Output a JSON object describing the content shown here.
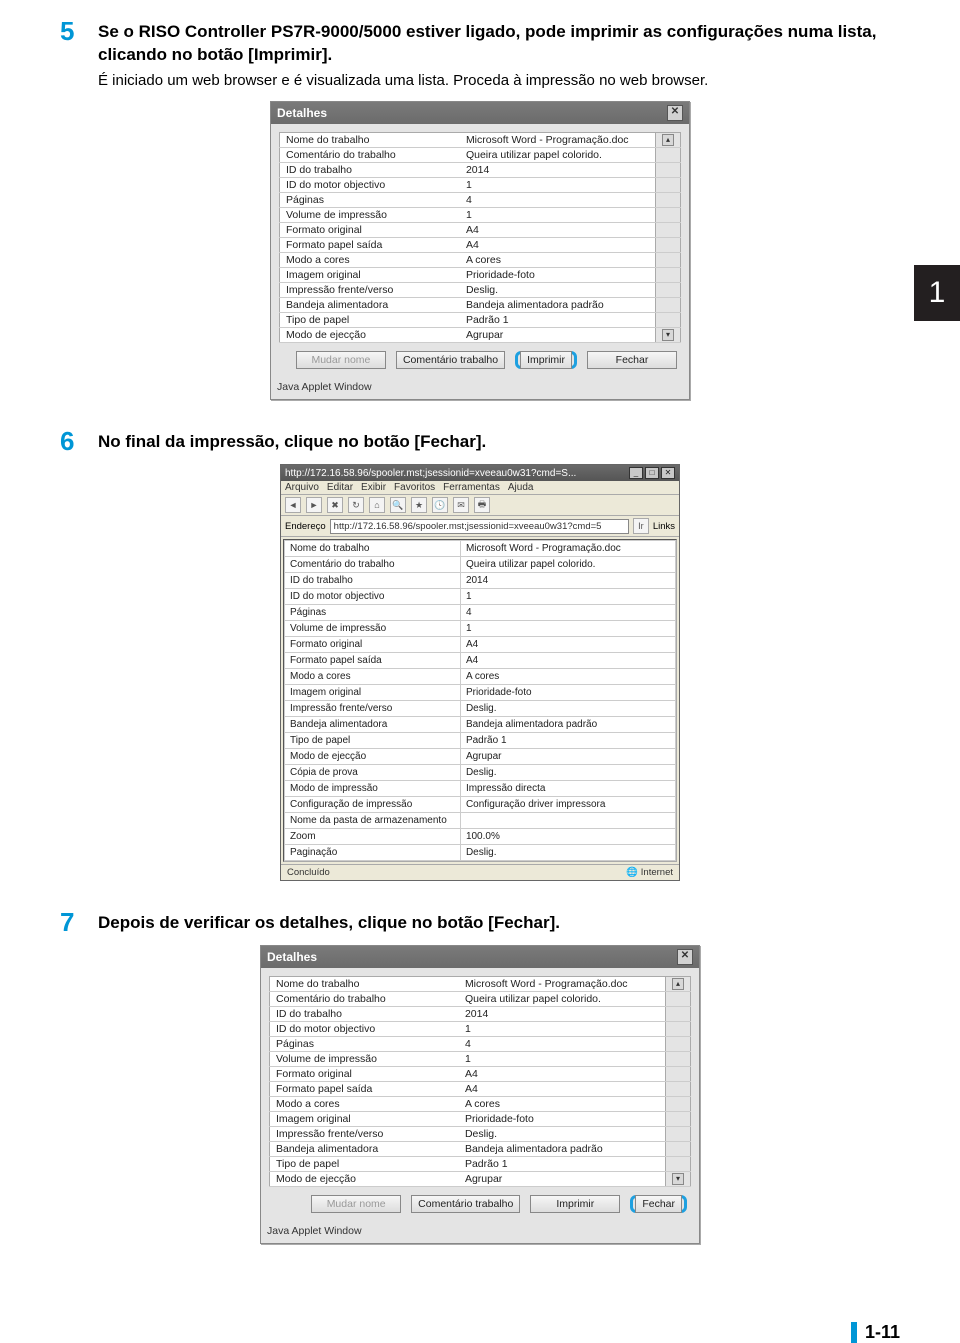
{
  "tab_marker": "1",
  "page_number": "1-11",
  "steps": {
    "s5": {
      "num": "5",
      "title": "Se o RISO Controller PS7R-9000/5000 estiver ligado, pode imprimir as configurações numa lista, clicando no botão [Imprimir].",
      "desc": "É iniciado um web browser e é visualizada uma lista. Proceda à impressão no web browser."
    },
    "s6": {
      "num": "6",
      "title": "No final da impressão, clique no botão [Fechar]."
    },
    "s7": {
      "num": "7",
      "title": "Depois de verificar os detalhes, clique no botão [Fechar]."
    }
  },
  "dlg": {
    "title": "Detalhes",
    "footer": "Java Applet Window",
    "buttons": {
      "rename": "Mudar nome",
      "comment": "Comentário trabalho",
      "print": "Imprimir",
      "close": "Fechar"
    },
    "rows1": [
      {
        "k": "Nome do trabalho",
        "v": "Microsoft Word - Programação.doc"
      },
      {
        "k": "Comentário do trabalho",
        "v": "Queira utilizar papel colorido."
      },
      {
        "k": "ID do trabalho",
        "v": "2014"
      },
      {
        "k": "ID do motor objectivo",
        "v": "1"
      },
      {
        "k": "Páginas",
        "v": "4"
      },
      {
        "k": "Volume de impressão",
        "v": "1"
      },
      {
        "k": "Formato original",
        "v": "A4"
      },
      {
        "k": "Formato papel saída",
        "v": "A4"
      },
      {
        "k": "Modo a cores",
        "v": "A cores"
      },
      {
        "k": "Imagem original",
        "v": "Prioridade-foto"
      },
      {
        "k": "Impressão frente/verso",
        "v": "Deslig."
      },
      {
        "k": "Bandeja alimentadora",
        "v": "Bandeja alimentadora padrão"
      },
      {
        "k": "Tipo de papel",
        "v": "Padrão 1"
      },
      {
        "k": "Modo de ejecção",
        "v": "Agrupar"
      }
    ],
    "rows3": [
      {
        "k": "Nome do trabalho",
        "v": "Microsoft Word - Programação.doc"
      },
      {
        "k": "Comentário do trabalho",
        "v": "Queira utilizar papel colorido."
      },
      {
        "k": "ID do trabalho",
        "v": "2014"
      },
      {
        "k": "ID do motor objectivo",
        "v": "1"
      },
      {
        "k": "Páginas",
        "v": "4"
      },
      {
        "k": "Volume de impressão",
        "v": "1"
      },
      {
        "k": "Formato original",
        "v": "A4"
      },
      {
        "k": "Formato papel saída",
        "v": "A4"
      },
      {
        "k": "Modo a cores",
        "v": "A cores"
      },
      {
        "k": "Imagem original",
        "v": "Prioridade-foto"
      },
      {
        "k": "Impressão frente/verso",
        "v": "Deslig."
      },
      {
        "k": "Bandeja alimentadora",
        "v": "Bandeja alimentadora padrão"
      },
      {
        "k": "Tipo de papel",
        "v": "Padrão 1"
      },
      {
        "k": "Modo de ejecção",
        "v": "Agrupar"
      }
    ]
  },
  "browser": {
    "title": "http://172.16.58.96/spooler.mst;jsessionid=xveeau0w31?cmd=S...",
    "menu": [
      "Arquivo",
      "Editar",
      "Exibir",
      "Favoritos",
      "Ferramentas",
      "Ajuda"
    ],
    "addr_label": "Endereço",
    "addr_value": "http://172.16.58.96/spooler.mst;jsessionid=xveeau0w31?cmd=5",
    "go": "Ir",
    "links": "Links",
    "rows": [
      {
        "k": "Nome do trabalho",
        "v": "Microsoft Word - Programação.doc"
      },
      {
        "k": "Comentário do trabalho",
        "v": "Queira utilizar papel colorido."
      },
      {
        "k": "ID do trabalho",
        "v": "2014"
      },
      {
        "k": "ID do motor objectivo",
        "v": "1"
      },
      {
        "k": "Páginas",
        "v": "4"
      },
      {
        "k": "Volume de impressão",
        "v": "1"
      },
      {
        "k": "Formato original",
        "v": "A4"
      },
      {
        "k": "Formato papel saída",
        "v": "A4"
      },
      {
        "k": "Modo a cores",
        "v": "A cores"
      },
      {
        "k": "Imagem original",
        "v": "Prioridade-foto"
      },
      {
        "k": "Impressão frente/verso",
        "v": "Deslig."
      },
      {
        "k": "Bandeja alimentadora",
        "v": "Bandeja alimentadora padrão"
      },
      {
        "k": "Tipo de papel",
        "v": "Padrão 1"
      },
      {
        "k": "Modo de ejecção",
        "v": "Agrupar"
      },
      {
        "k": "Cópia de prova",
        "v": "Deslig."
      },
      {
        "k": "Modo de impressão",
        "v": "Impressão directa"
      },
      {
        "k": "Configuração de impressão",
        "v": "Configuração driver impressora"
      },
      {
        "k": "Nome da pasta de armazenamento",
        "v": ""
      },
      {
        "k": "Zoom",
        "v": "100.0%"
      },
      {
        "k": "Paginação",
        "v": "Deslig."
      }
    ],
    "status_done": "Concluído",
    "status_zone": "Internet"
  }
}
